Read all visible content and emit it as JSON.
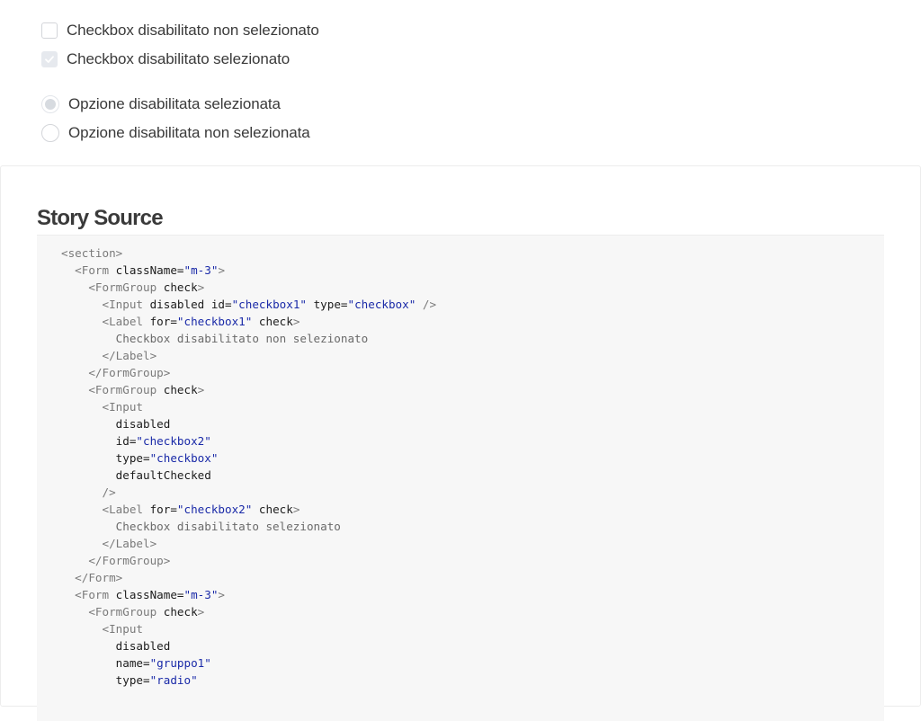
{
  "controls": {
    "checkbox_unchecked_label": "Checkbox disabilitato non selezionato",
    "checkbox_checked_label": "Checkbox disabilitato selezionato",
    "radio_checked_label": "Opzione disabilitata selezionata",
    "radio_unchecked_label": "Opzione disabilitata non selezionata"
  },
  "story": {
    "title": "Story Source",
    "code_lines": [
      {
        "indent": 0,
        "tokens": [
          {
            "c": "tag",
            "t": "<section>"
          }
        ]
      },
      {
        "indent": 1,
        "tokens": [
          {
            "c": "tag",
            "t": "<Form "
          },
          {
            "c": "attr",
            "t": "className"
          },
          {
            "c": "attr",
            "t": "="
          },
          {
            "c": "str",
            "t": "\"m-3\""
          },
          {
            "c": "tag",
            "t": ">"
          }
        ]
      },
      {
        "indent": 2,
        "tokens": [
          {
            "c": "tag",
            "t": "<FormGroup "
          },
          {
            "c": "attr",
            "t": "check"
          },
          {
            "c": "tag",
            "t": ">"
          }
        ]
      },
      {
        "indent": 3,
        "tokens": [
          {
            "c": "tag",
            "t": "<Input "
          },
          {
            "c": "attr",
            "t": "disabled id="
          },
          {
            "c": "str",
            "t": "\"checkbox1\""
          },
          {
            "c": "attr",
            "t": " type="
          },
          {
            "c": "str",
            "t": "\"checkbox\""
          },
          {
            "c": "tag",
            "t": " />"
          }
        ]
      },
      {
        "indent": 3,
        "tokens": [
          {
            "c": "tag",
            "t": "<Label "
          },
          {
            "c": "attr",
            "t": "for="
          },
          {
            "c": "str",
            "t": "\"checkbox1\""
          },
          {
            "c": "attr",
            "t": " check"
          },
          {
            "c": "tag",
            "t": ">"
          }
        ]
      },
      {
        "indent": 4,
        "tokens": [
          {
            "c": "text",
            "t": "Checkbox disabilitato non selezionato"
          }
        ]
      },
      {
        "indent": 3,
        "tokens": [
          {
            "c": "tag",
            "t": "</Label>"
          }
        ]
      },
      {
        "indent": 2,
        "tokens": [
          {
            "c": "tag",
            "t": "</FormGroup>"
          }
        ]
      },
      {
        "indent": 2,
        "tokens": [
          {
            "c": "tag",
            "t": "<FormGroup "
          },
          {
            "c": "attr",
            "t": "check"
          },
          {
            "c": "tag",
            "t": ">"
          }
        ]
      },
      {
        "indent": 3,
        "tokens": [
          {
            "c": "tag",
            "t": "<Input"
          }
        ]
      },
      {
        "indent": 4,
        "tokens": [
          {
            "c": "attr",
            "t": "disabled"
          }
        ]
      },
      {
        "indent": 4,
        "tokens": [
          {
            "c": "attr",
            "t": "id="
          },
          {
            "c": "str",
            "t": "\"checkbox2\""
          }
        ]
      },
      {
        "indent": 4,
        "tokens": [
          {
            "c": "attr",
            "t": "type="
          },
          {
            "c": "str",
            "t": "\"checkbox\""
          }
        ]
      },
      {
        "indent": 4,
        "tokens": [
          {
            "c": "attr",
            "t": "defaultChecked"
          }
        ]
      },
      {
        "indent": 3,
        "tokens": [
          {
            "c": "tag",
            "t": "/>"
          }
        ]
      },
      {
        "indent": 3,
        "tokens": [
          {
            "c": "tag",
            "t": "<Label "
          },
          {
            "c": "attr",
            "t": "for="
          },
          {
            "c": "str",
            "t": "\"checkbox2\""
          },
          {
            "c": "attr",
            "t": " check"
          },
          {
            "c": "tag",
            "t": ">"
          }
        ]
      },
      {
        "indent": 4,
        "tokens": [
          {
            "c": "text",
            "t": "Checkbox disabilitato selezionato"
          }
        ]
      },
      {
        "indent": 3,
        "tokens": [
          {
            "c": "tag",
            "t": "</Label>"
          }
        ]
      },
      {
        "indent": 2,
        "tokens": [
          {
            "c": "tag",
            "t": "</FormGroup>"
          }
        ]
      },
      {
        "indent": 1,
        "tokens": [
          {
            "c": "tag",
            "t": "</Form>"
          }
        ]
      },
      {
        "indent": 1,
        "tokens": [
          {
            "c": "tag",
            "t": "<Form "
          },
          {
            "c": "attr",
            "t": "className="
          },
          {
            "c": "str",
            "t": "\"m-3\""
          },
          {
            "c": "tag",
            "t": ">"
          }
        ]
      },
      {
        "indent": 2,
        "tokens": [
          {
            "c": "tag",
            "t": "<FormGroup "
          },
          {
            "c": "attr",
            "t": "check"
          },
          {
            "c": "tag",
            "t": ">"
          }
        ]
      },
      {
        "indent": 3,
        "tokens": [
          {
            "c": "tag",
            "t": "<Input"
          }
        ]
      },
      {
        "indent": 4,
        "tokens": [
          {
            "c": "attr",
            "t": "disabled"
          }
        ]
      },
      {
        "indent": 4,
        "tokens": [
          {
            "c": "attr",
            "t": "name="
          },
          {
            "c": "str",
            "t": "\"gruppo1\""
          }
        ]
      },
      {
        "indent": 4,
        "tokens": [
          {
            "c": "attr",
            "t": "type="
          },
          {
            "c": "str",
            "t": "\"radio\""
          }
        ]
      }
    ]
  }
}
